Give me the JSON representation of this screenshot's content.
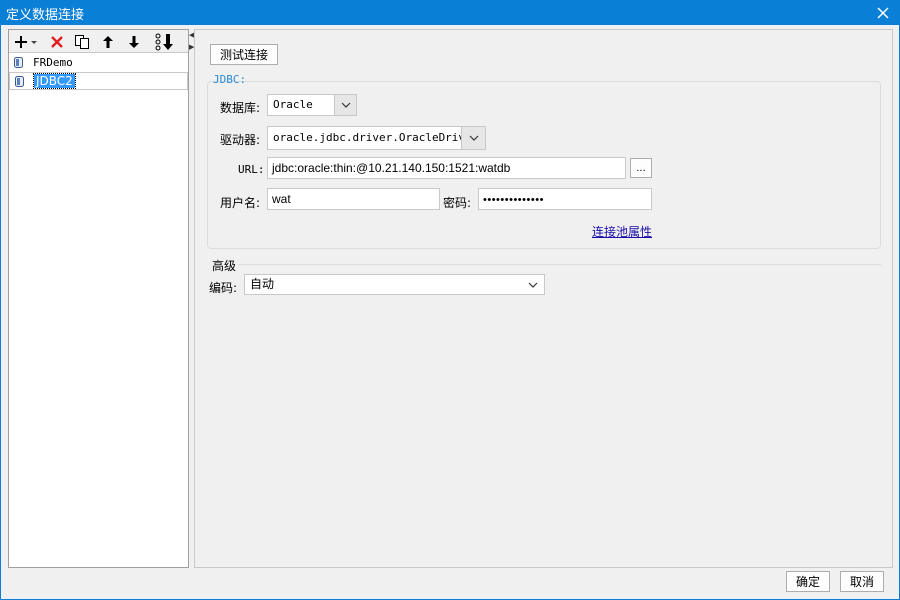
{
  "window": {
    "title": "定义数据连接"
  },
  "tree": {
    "items": [
      {
        "label": "FRDemo",
        "selected": false
      },
      {
        "label": "JDBC2",
        "selected": true
      }
    ]
  },
  "form": {
    "test_button": "测试连接",
    "group_label": "JDBC:",
    "database_label": "数据库:",
    "database_value": "Oracle",
    "driver_label": "驱动器:",
    "driver_value": "oracle.jdbc.driver.OracleDriver",
    "url_label": "URL:",
    "url_value": "jdbc:oracle:thin:@10.21.140.150:1521:watdb",
    "url_browse": "...",
    "username_label": "用户名:",
    "username_value": "wat",
    "password_label": "密码:",
    "password_value": "••••••••••••••",
    "pool_link": "连接池属性",
    "advanced_title": "高级",
    "encoding_label": "编码:",
    "encoding_value": "自动"
  },
  "footer": {
    "ok": "确定",
    "cancel": "取消"
  },
  "colors": {
    "titlebar": "#0a7fd6",
    "selection": "#3399ff",
    "link": "#1a0dab",
    "group_label": "#2a8ad8"
  }
}
